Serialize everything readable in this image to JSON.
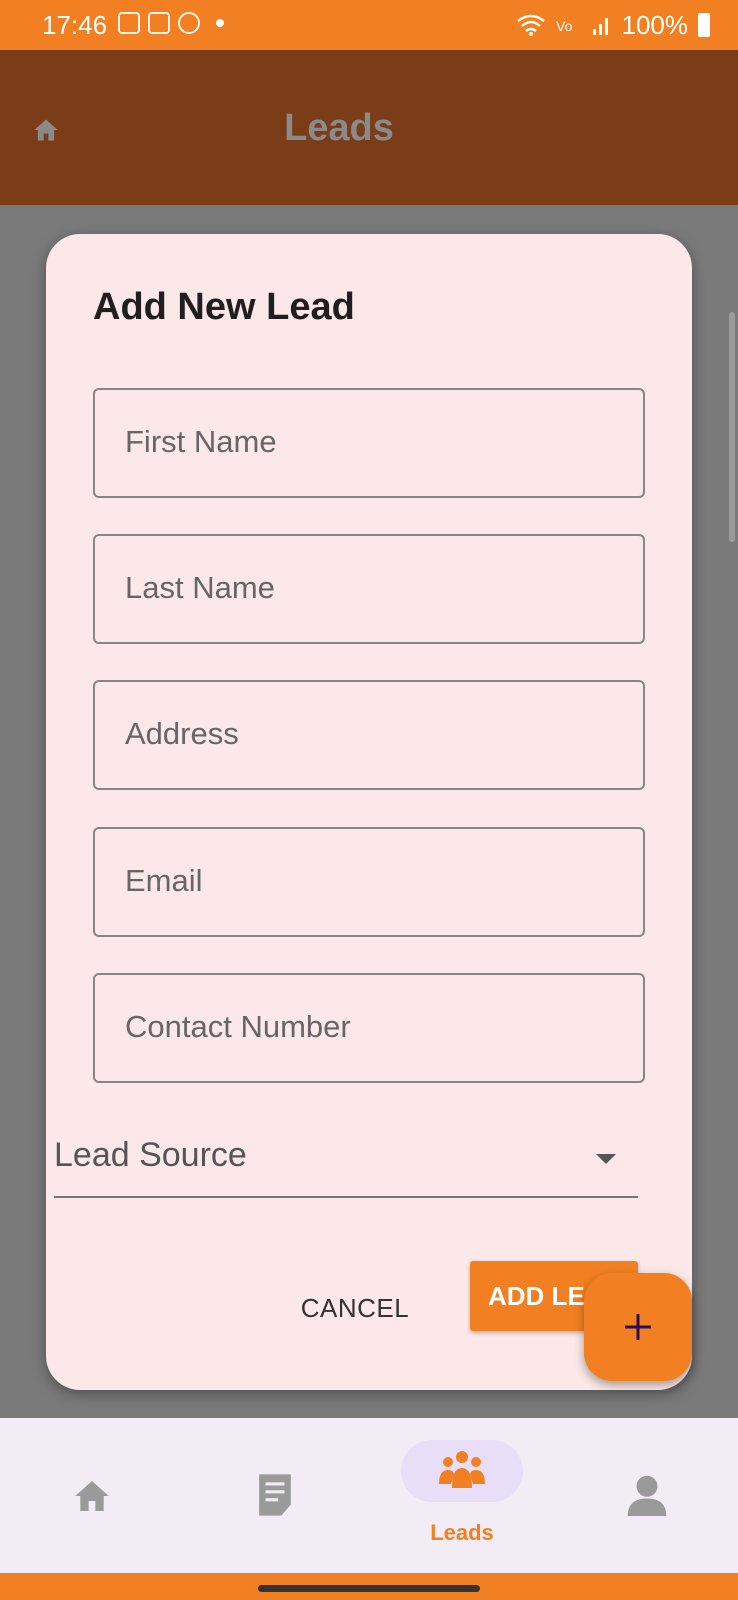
{
  "status_bar": {
    "time": "17:46",
    "battery": "100%"
  },
  "app_bar": {
    "title": "Leads",
    "home_icon": "home-icon"
  },
  "dialog": {
    "title": "Add New Lead",
    "fields": [
      {
        "placeholder": "First Name",
        "value": ""
      },
      {
        "placeholder": "Last Name",
        "value": ""
      },
      {
        "placeholder": "Address",
        "value": ""
      },
      {
        "placeholder": "Email",
        "value": ""
      },
      {
        "placeholder": "Contact Number",
        "value": ""
      }
    ],
    "lead_source": {
      "placeholder": "Lead Source",
      "value": ""
    },
    "cancel_label": "CANCEL",
    "add_label": "ADD LE"
  },
  "fab": {
    "label": "+"
  },
  "bottom_nav": {
    "items": [
      {
        "icon": "home-icon",
        "label": ""
      },
      {
        "icon": "document-icon",
        "label": ""
      },
      {
        "icon": "group-icon",
        "label": "Leads",
        "active": true
      },
      {
        "icon": "person-icon",
        "label": ""
      }
    ]
  },
  "colors": {
    "accent": "#f28022",
    "app_bar": "#7a3d18",
    "dialog_bg": "#fce8e8",
    "nav_bg": "#f2ecf4",
    "nav_pill": "#e8def8"
  }
}
